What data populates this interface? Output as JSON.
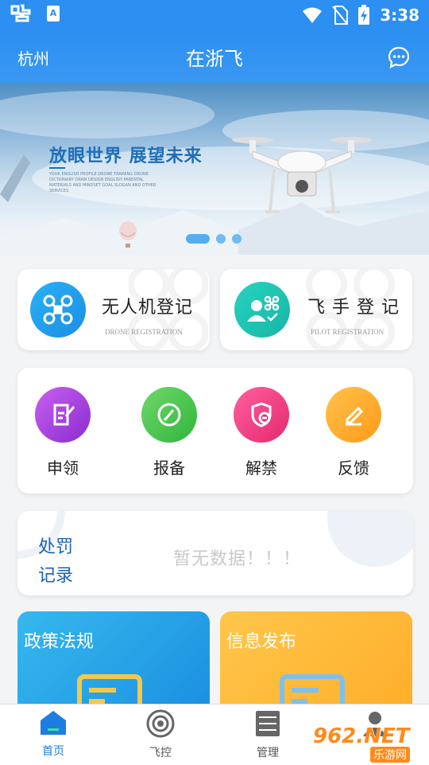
{
  "status_bar": {
    "time": "3:38"
  },
  "app_bar": {
    "city": "杭州",
    "title": "在浙飞"
  },
  "banner": {
    "slogan": "放眼世界  展望未来",
    "fine_print": "YOUR ENGLISH PROFILE DRONE TRAINING DRONE DICTIONARY DRAW DESIGN ENGLISH PARENTAL MATERIALS AND MINDSET GOAL SLOGAN AND OTHER SERVICES",
    "pages": 3,
    "active_page": 1
  },
  "registration": {
    "drone": {
      "title": "无人机登记",
      "subtitle": "DRONE REGISTRATION"
    },
    "pilot": {
      "title": "飞 手 登 记",
      "subtitle": "PILOT REGISTRATION"
    }
  },
  "services": [
    {
      "label": "申领",
      "icon": "apply-icon"
    },
    {
      "label": "报备",
      "icon": "report-icon"
    },
    {
      "label": "解禁",
      "icon": "unban-icon"
    },
    {
      "label": "反馈",
      "icon": "feedback-icon"
    }
  ],
  "penalty": {
    "title": "处罚记录",
    "empty": "暂无数据！！！"
  },
  "tiles": [
    {
      "title": "政策法规",
      "icon": "policy-icon"
    },
    {
      "title": "信息发布",
      "icon": "news-icon"
    }
  ],
  "tabs": [
    {
      "label": "首页",
      "icon": "home-icon",
      "active": true
    },
    {
      "label": "飞控",
      "icon": "flight-control-icon",
      "active": false
    },
    {
      "label": "管理",
      "icon": "manage-icon",
      "active": false
    },
    {
      "label": "",
      "icon": "profile-icon",
      "active": false
    }
  ],
  "watermark": {
    "text": "962.NET",
    "subtext": "乐游网"
  },
  "colors": {
    "primary": "#2c8ff1",
    "tab_active": "#1e7de0",
    "tab_inactive": "#555555"
  }
}
